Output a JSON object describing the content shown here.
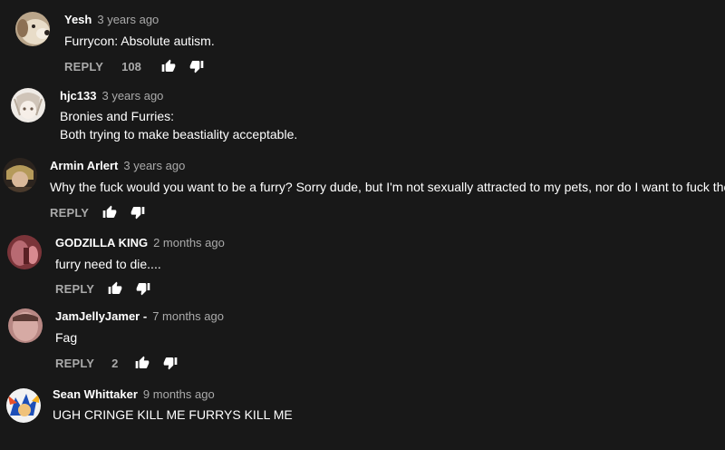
{
  "comments": [
    {
      "author": "Yesh",
      "time": "3 years ago",
      "lines": [
        "Furrycon: Absolute autism."
      ],
      "reply_label": "REPLY",
      "likes": "108",
      "avatar_icon": "dog-avatar",
      "avatar_color": "#c9b8a0"
    },
    {
      "author": "hjc133",
      "time": "3 years ago",
      "lines": [
        "Bronies and Furries:",
        "Both trying to make beastiality acceptable."
      ],
      "avatar_icon": "anime-avatar",
      "avatar_color": "#e6e1dc"
    },
    {
      "author": "Armin Arlert",
      "time": "3 years ago",
      "lines": [
        "Why the fuck would you want to be a furry? Sorry dude, but I'm not sexually attracted to my pets, nor do I want to fuck them."
      ],
      "reply_label": "REPLY",
      "avatar_icon": "armin-avatar",
      "avatar_color": "#3a2e25"
    },
    {
      "author": "GODZILLA KING",
      "time": "2 months ago",
      "lines": [
        "furry need to die...."
      ],
      "reply_label": "REPLY",
      "avatar_icon": "godzilla-avatar",
      "avatar_color": "#8a3b3f"
    },
    {
      "author": "JamJellyJamer -",
      "time": "7 months ago",
      "lines": [
        "Fag"
      ],
      "reply_label": "REPLY",
      "likes": "2",
      "avatar_icon": "face-avatar",
      "avatar_color": "#c89a96"
    },
    {
      "author": "Sean Whittaker",
      "time": "9 months ago",
      "lines": [
        "UGH CRINGE KILL ME FURRYS KILL ME"
      ],
      "avatar_icon": "sonic-avatar",
      "avatar_color": "#1d4fb8"
    }
  ],
  "colors": {
    "background": "#181818",
    "text": "#ffffff",
    "secondary": "#aaaaaa"
  }
}
